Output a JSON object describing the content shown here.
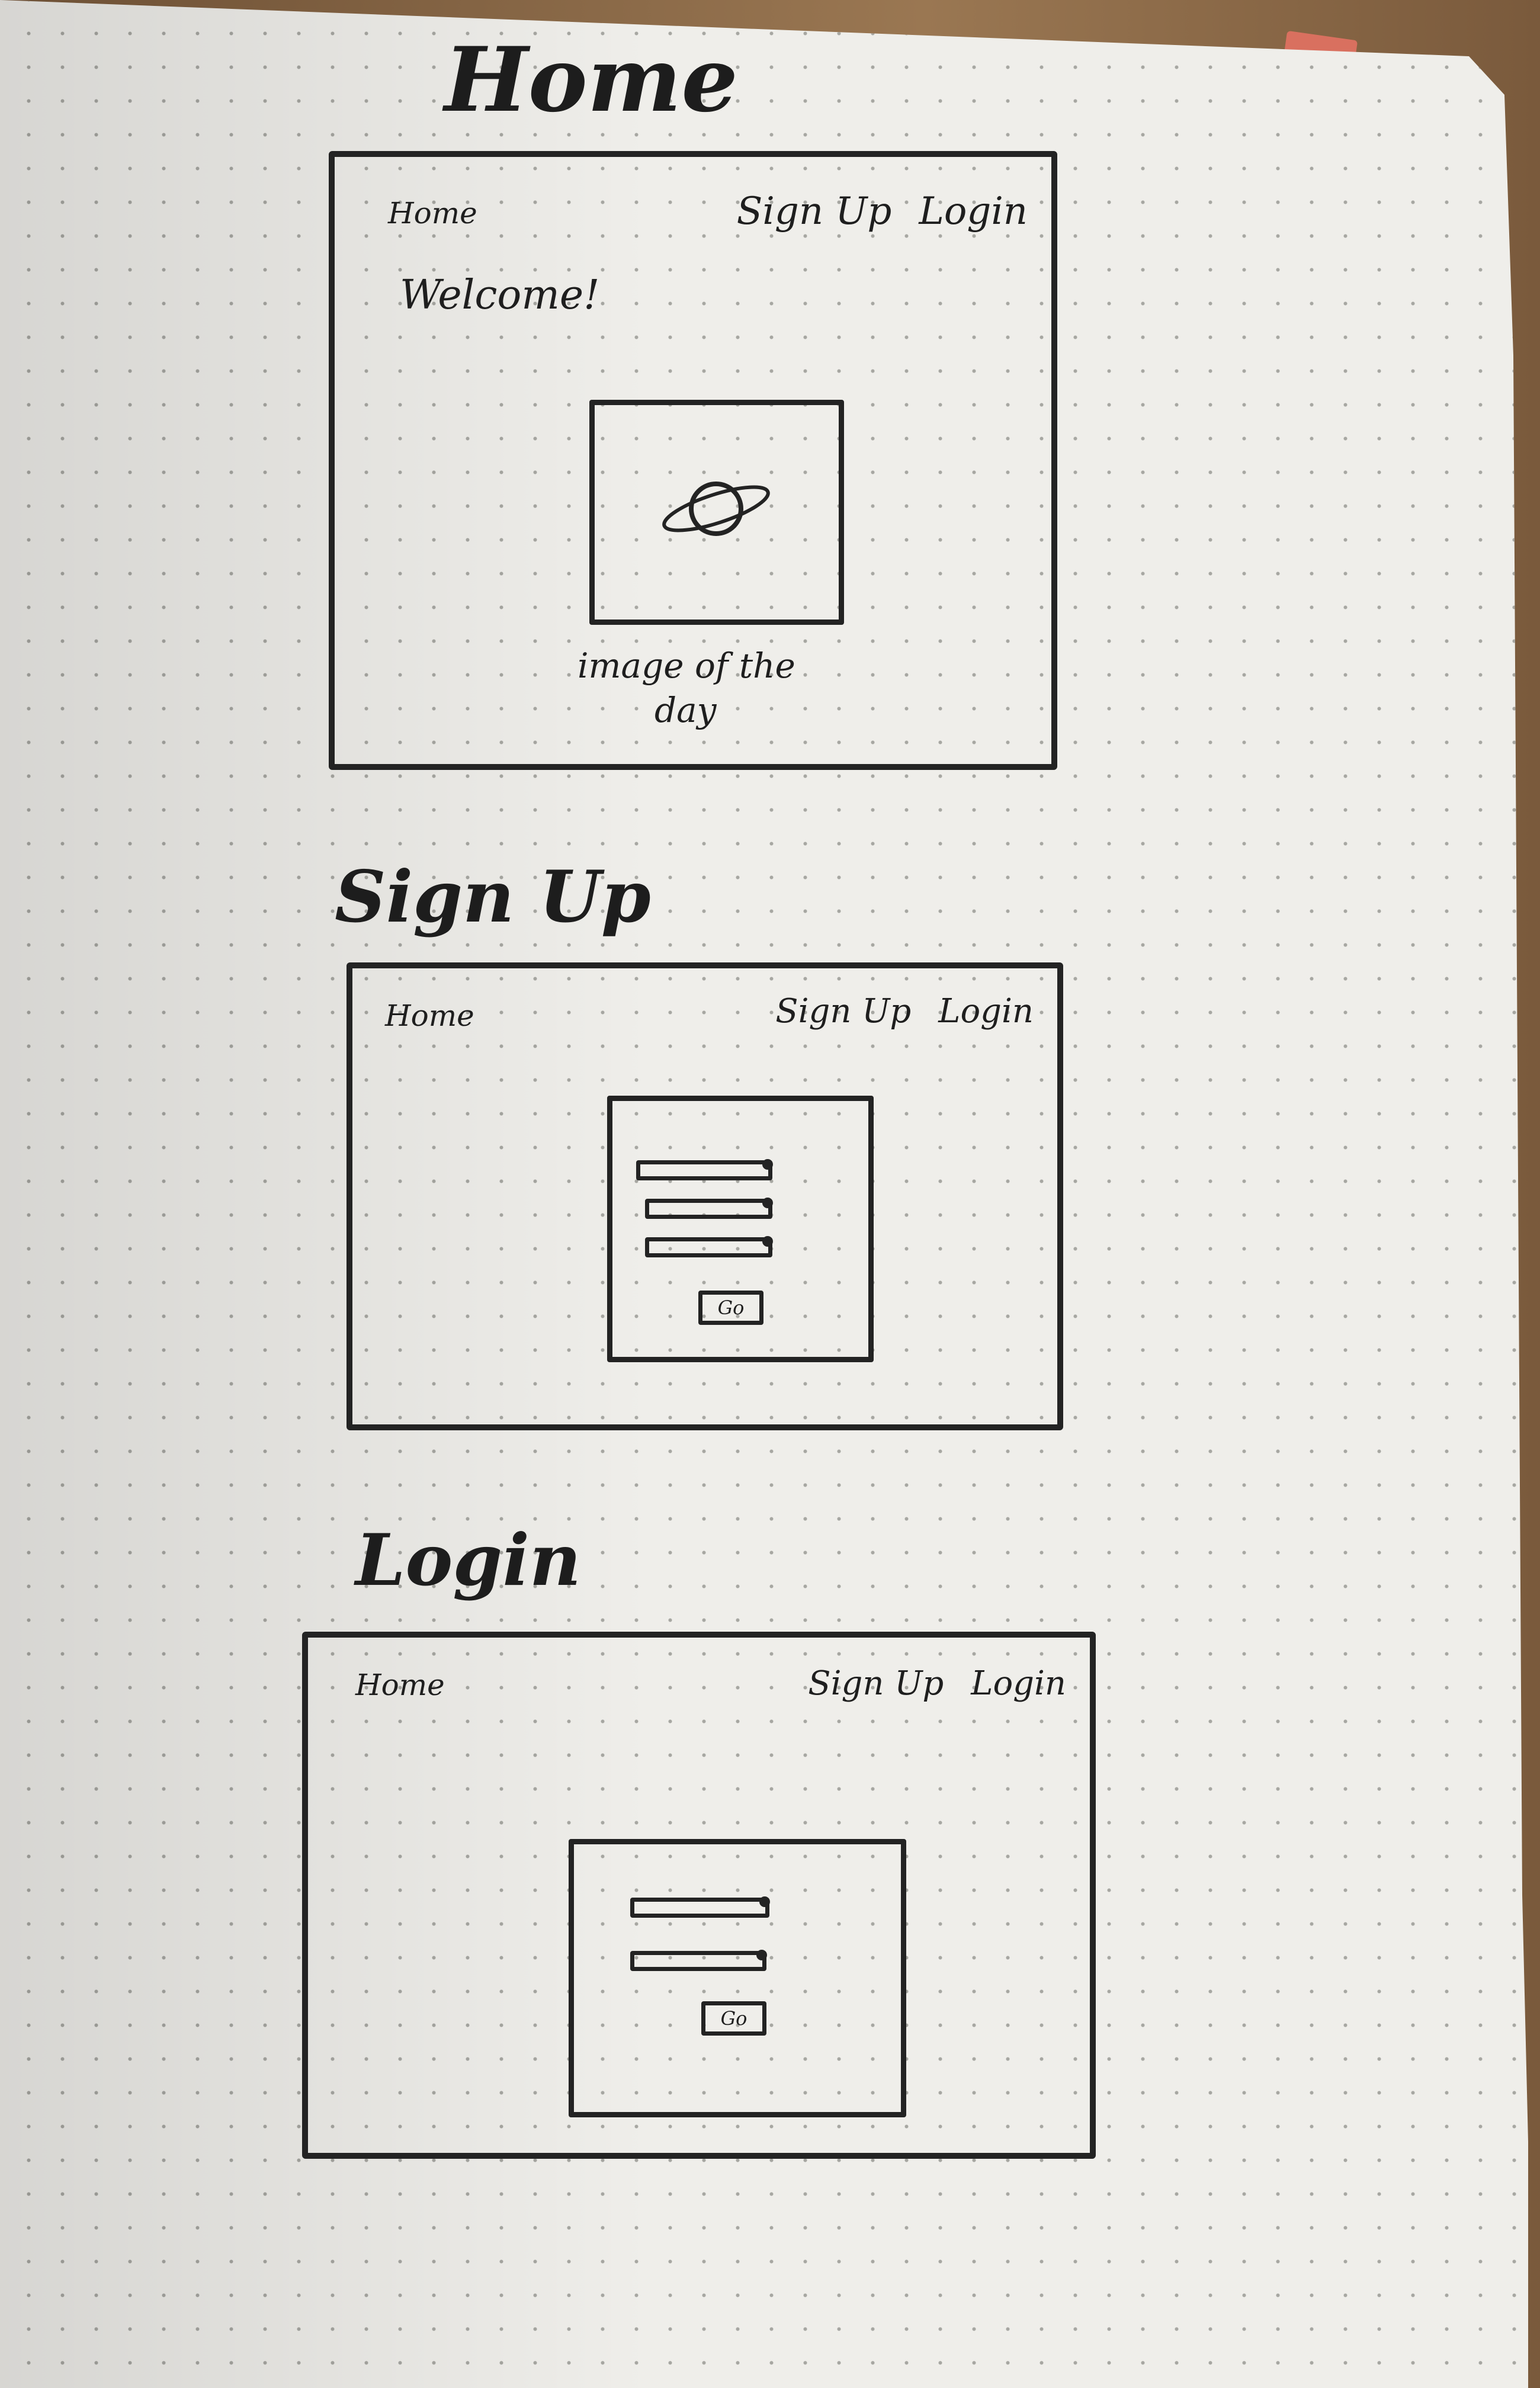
{
  "home_section": {
    "heading": "Home",
    "nav": {
      "home": "Home",
      "signup": "Sign Up",
      "login": "Login"
    },
    "welcome": "Welcome!",
    "image_caption_line1": "image of the",
    "image_caption_line2": "day"
  },
  "signup_section": {
    "heading": "Sign Up",
    "nav": {
      "home": "Home",
      "signup": "Sign Up",
      "login": "Login"
    },
    "go_label": "Go"
  },
  "login_section": {
    "heading": "Login",
    "nav": {
      "home": "Home",
      "signup": "Sign Up",
      "login": "Login"
    },
    "go_label": "Go"
  },
  "colors": {
    "paper": "#efeeea",
    "ink": "#232323",
    "bookmark": "#d9705f"
  },
  "icons": [
    "planet-icon"
  ]
}
